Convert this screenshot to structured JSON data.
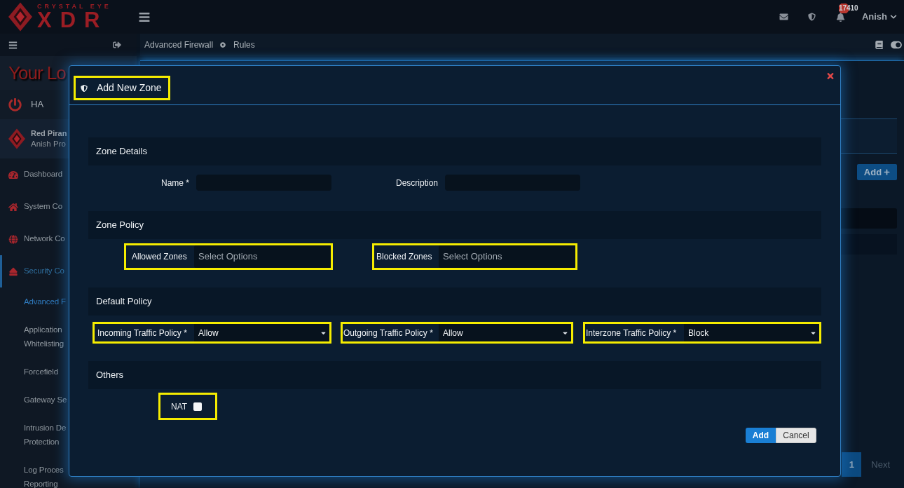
{
  "header": {
    "logo": {
      "tagline": "CRYSTAL EYE",
      "wordmark": "XDR"
    },
    "notification_count": "17410",
    "user": "Anish"
  },
  "breadcrumb": [
    "Advanced Firewall",
    "Rules"
  ],
  "sidebar": {
    "logo_text": "Your Lo",
    "status": "HA",
    "profile": {
      "name": "Red Piran",
      "subtitle": "Anish Pro"
    },
    "menu": [
      {
        "label": "Dashboard",
        "selected": false
      },
      {
        "label": "System Co",
        "selected": false
      },
      {
        "label": "Network Co",
        "selected": false
      },
      {
        "label": "Security Co",
        "selected": true,
        "children": [
          {
            "label": "Advanced F",
            "selected": true
          },
          {
            "label": "Application\nWhitelisting",
            "selected": false
          },
          {
            "label": "Forcefield",
            "selected": false
          },
          {
            "label": "Gateway Se",
            "selected": false
          },
          {
            "label": "Intrusion De\nProtection",
            "selected": false
          },
          {
            "label": "Log Proces\nReporting",
            "selected": false
          }
        ]
      }
    ]
  },
  "content": {
    "add_button": "Add",
    "pagination": {
      "pages": [
        {
          "label": "1",
          "selected": true
        }
      ],
      "next": "Next"
    }
  },
  "modal": {
    "title": "Add New Zone",
    "title_highlighted": true,
    "sections": [
      {
        "title": "Zone Details",
        "fields": [
          {
            "kind": "text",
            "label": "Name *",
            "highlighted": false
          },
          {
            "kind": "text",
            "label": "Description",
            "highlighted": false
          }
        ]
      },
      {
        "title": "Zone Policy",
        "fields": [
          {
            "kind": "multiselect",
            "label": "Allowed Zones",
            "placeholder": "Select Options",
            "highlighted": true
          },
          {
            "kind": "multiselect",
            "label": "Blocked Zones",
            "placeholder": "Select Options",
            "highlighted": true
          }
        ]
      },
      {
        "title": "Default Policy",
        "fields": [
          {
            "kind": "select",
            "label": "Incoming Traffic Policy *",
            "value": "Allow",
            "highlighted": true
          },
          {
            "kind": "select",
            "label": "Outgoing Traffic Policy *",
            "value": "Allow",
            "highlighted": true
          },
          {
            "kind": "select",
            "label": "Interzone Traffic Policy *",
            "value": "Block",
            "highlighted": true
          }
        ]
      },
      {
        "title": "Others",
        "fields": [
          {
            "kind": "checkbox",
            "label": "NAT",
            "checked": false,
            "highlighted": true
          }
        ]
      }
    ],
    "buttons": [
      {
        "label": "Add",
        "kind": "primary"
      },
      {
        "label": "Cancel",
        "kind": "secondary"
      }
    ]
  }
}
